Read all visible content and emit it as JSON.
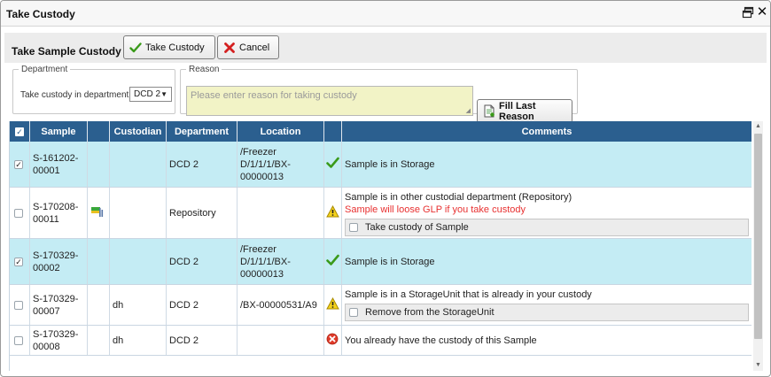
{
  "window": {
    "title": "Take Custody",
    "maximize_icon": "restore-window-icon",
    "close_icon": "close-icon",
    "close_glyph": "✕"
  },
  "toolbar": {
    "page_title": "Take Sample Custody",
    "take_custody_label": "Take Custody",
    "cancel_label": "Cancel"
  },
  "department": {
    "legend": "Department",
    "label": "Take custody in department",
    "selected": "DCD 2"
  },
  "reason": {
    "legend": "Reason",
    "placeholder": "Please enter reason for taking custody",
    "fill_last_label": "Fill Last Reason"
  },
  "table": {
    "columns": [
      "",
      "Sample",
      "",
      "Custodian",
      "Department",
      "Location",
      "",
      "Comments"
    ],
    "rows": [
      {
        "checked": true,
        "selected": true,
        "sample": "S-161202-00001",
        "sample_line1": "S-161202-",
        "sample_line2": "00001",
        "custodian": "",
        "department": "DCD 2",
        "location_lines": [
          "/Freezer",
          "D/1/1/1/BX-",
          "00000013"
        ],
        "status_icon": "check-icon",
        "comment": "Sample is in Storage"
      },
      {
        "checked": false,
        "selected": false,
        "sample": "S-170208-00011",
        "sample_line1": "S-170208-",
        "sample_line2": "00011",
        "has_icon": "custodial-flag-icon",
        "custodian": "",
        "department": "Repository",
        "location_lines": [],
        "status_icon": "warning-icon",
        "comment": "Sample is in other custodial department (Repository)",
        "warning": "Sample will loose GLP if you take custody",
        "option_label": "Take custody of Sample"
      },
      {
        "checked": true,
        "selected": true,
        "sample": "S-170329-00002",
        "sample_line1": "S-170329-",
        "sample_line2": "00002",
        "custodian": "",
        "department": "DCD 2",
        "location_lines": [
          "/Freezer",
          "D/1/1/1/BX-",
          "00000013"
        ],
        "status_icon": "check-icon",
        "comment": "Sample is in Storage"
      },
      {
        "checked": false,
        "selected": false,
        "sample": "S-170329-00007",
        "sample_line1": "S-170329-",
        "sample_line2": "00007",
        "custodian": "dh",
        "department": "DCD 2",
        "location_lines": [
          "/BX-00000531/A9"
        ],
        "status_icon": "warning-icon",
        "comment": "Sample is in a StorageUnit that is already in your custody",
        "option_label": "Remove from the StorageUnit"
      },
      {
        "checked": false,
        "selected": false,
        "sample": "S-170329-00008",
        "sample_line1": "S-170329-",
        "sample_line2": "00008",
        "custodian": "dh",
        "department": "DCD 2",
        "location_lines": [],
        "status_icon": "error-icon",
        "comment": "You already have the custody of this Sample"
      }
    ]
  },
  "colors": {
    "header_bg": "#2b5f8f",
    "selected_row_bg": "#c4ecf4",
    "reason_bg": "#f2f3c6",
    "warning_text": "#e83030",
    "check_green": "#3a9a1a",
    "error_red": "#e03b2a"
  }
}
